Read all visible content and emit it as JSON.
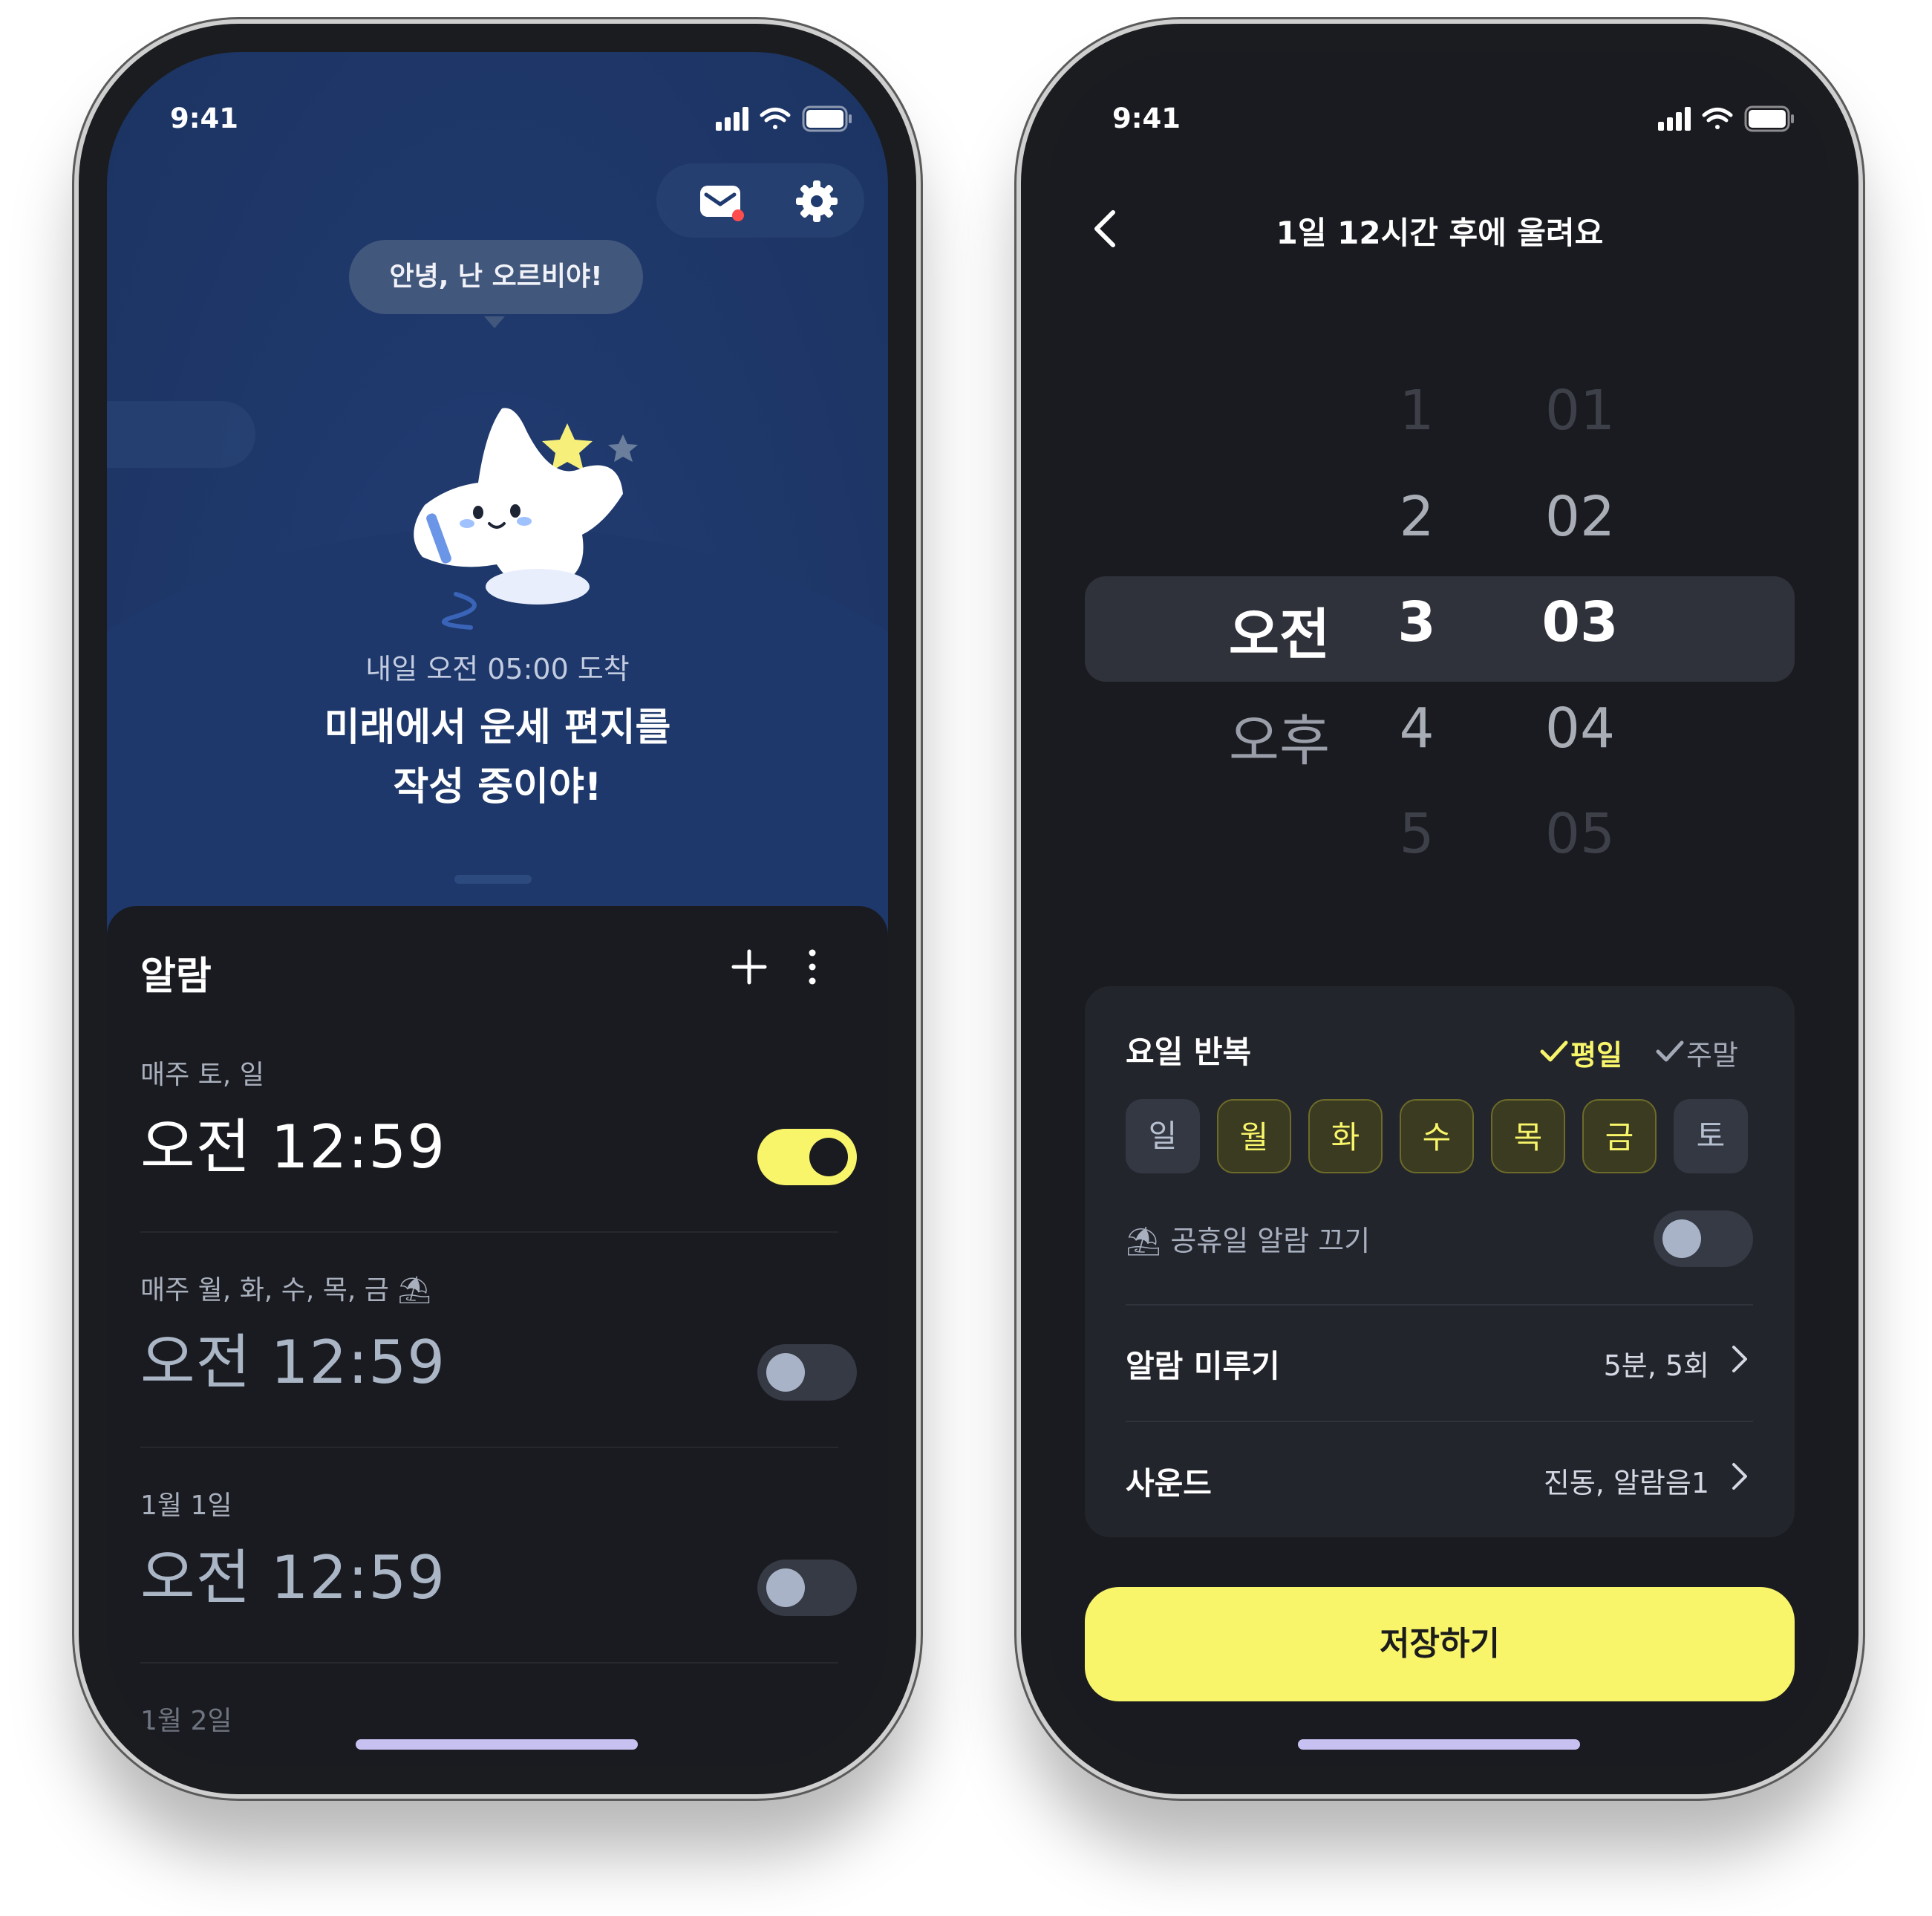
{
  "left_screen": {
    "status": {
      "time": "9:41"
    },
    "bubble": "안녕, 난 오르비야!",
    "arrival": "내일 오전 05:00 도착",
    "headline_line1": "미래에서 운세 편지를",
    "headline_line2": "작성 중이야!",
    "alarm_section": {
      "title": "알람",
      "alarms": [
        {
          "repeat": "매주 토, 일",
          "time": "오전 12:59",
          "enabled": true
        },
        {
          "repeat": "매주 월, 화, 수, 목, 금 ⛱",
          "time": "오전 12:59",
          "enabled": false
        },
        {
          "repeat": "1월 1일",
          "time": "오전 12:59",
          "enabled": false
        },
        {
          "repeat": "1월 2일"
        }
      ]
    }
  },
  "right_screen": {
    "status": {
      "time": "9:41"
    },
    "nav_title": "1일 12시간 후에 울려요",
    "picker": {
      "ampm": [
        "오전",
        "오후"
      ],
      "hours": [
        "1",
        "2",
        "3",
        "4",
        "5"
      ],
      "minutes": [
        "01",
        "02",
        "03",
        "04",
        "05"
      ],
      "selected": {
        "ampm": "오전",
        "hour": "3",
        "minute": "03"
      }
    },
    "repeat": {
      "label": "요일 반복",
      "weekday_option": "평일",
      "weekend_option": "주말",
      "days": [
        {
          "label": "일",
          "selected": false
        },
        {
          "label": "월",
          "selected": true
        },
        {
          "label": "화",
          "selected": true
        },
        {
          "label": "수",
          "selected": true
        },
        {
          "label": "목",
          "selected": true
        },
        {
          "label": "금",
          "selected": true
        },
        {
          "label": "토",
          "selected": false
        }
      ]
    },
    "holiday_off": {
      "label": "⛱ 공휴일 알람 끄기",
      "enabled": false
    },
    "snooze": {
      "label": "알람 미루기",
      "value": "5분, 5회"
    },
    "sound": {
      "label": "사운드",
      "value": "진동, 알람음1"
    },
    "save_label": "저장하기"
  },
  "colors": {
    "accent_yellow": "#F8F56B",
    "background_dark": "#1A1B20",
    "hero_blue": "#1E386B"
  },
  "icons": [
    "signal-icon",
    "wifi-icon",
    "battery-icon",
    "mail-icon",
    "gear-icon",
    "plus-icon",
    "more-icon",
    "back-chevron-icon",
    "check-icon",
    "chevron-right-icon"
  ]
}
